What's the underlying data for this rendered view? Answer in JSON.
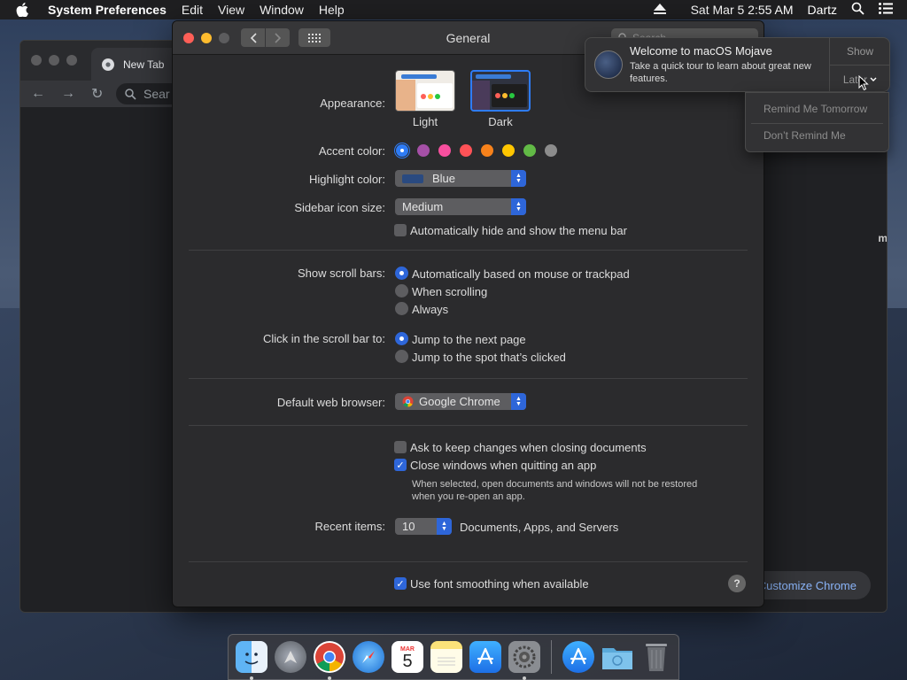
{
  "menubar": {
    "app_name": "System Preferences",
    "items": [
      "Edit",
      "View",
      "Window",
      "Help"
    ],
    "datetime": "Sat Mar 5  2:55 AM",
    "user": "Dartz"
  },
  "chrome": {
    "tab_title": "New Tab",
    "omnibox": "Sear",
    "customize_label": "Customize Chrome",
    "side_text": "m"
  },
  "prefs": {
    "title": "General",
    "search_placeholder": "Search",
    "appearance": {
      "label": "Appearance:",
      "light": "Light",
      "dark": "Dark",
      "selected": "Dark"
    },
    "accent": {
      "label": "Accent color:",
      "colors": [
        "#2e7cf6",
        "#a550a7",
        "#f74f9e",
        "#ff5257",
        "#f7821b",
        "#ffc600",
        "#62ba46",
        "#8c8c8c"
      ],
      "selected": "Blue"
    },
    "highlight": {
      "label": "Highlight color:",
      "value": "Blue",
      "swatch": "#2a4a80"
    },
    "sidebar_size": {
      "label": "Sidebar icon size:",
      "value": "Medium"
    },
    "menu_bar_hide": {
      "label": "Automatically hide and show the menu bar",
      "checked": false
    },
    "scroll_bars": {
      "label": "Show scroll bars:",
      "options": [
        "Automatically based on mouse or trackpad",
        "When scrolling",
        "Always"
      ],
      "selected": "Automatically based on mouse or trackpad"
    },
    "scroll_click": {
      "label": "Click in the scroll bar to:",
      "options": [
        "Jump to the next page",
        "Jump to the spot that’s clicked"
      ],
      "selected": "Jump to the next page"
    },
    "browser": {
      "label": "Default web browser:",
      "value": "Google Chrome"
    },
    "ask_keep": {
      "label": "Ask to keep changes when closing documents",
      "checked": false
    },
    "close_windows": {
      "label": "Close windows when quitting an app",
      "checked": true,
      "note_line1": "When selected, open documents and windows will not be restored",
      "note_line2": "when you re-open an app."
    },
    "recent": {
      "label": "Recent items:",
      "value": "10",
      "suffix": "Documents, Apps, and Servers"
    },
    "font_smoothing": {
      "label": "Use font smoothing when available",
      "checked": true
    },
    "help": "?"
  },
  "notification": {
    "title": "Welcome to macOS Mojave",
    "message": "Take a quick tour to learn about great new features.",
    "show": "Show",
    "later": "Later",
    "menu": [
      "Remind Me Tomorrow",
      "Don’t Remind Me"
    ]
  },
  "dock": {
    "calendar_month": "MAR",
    "calendar_day": "5"
  }
}
